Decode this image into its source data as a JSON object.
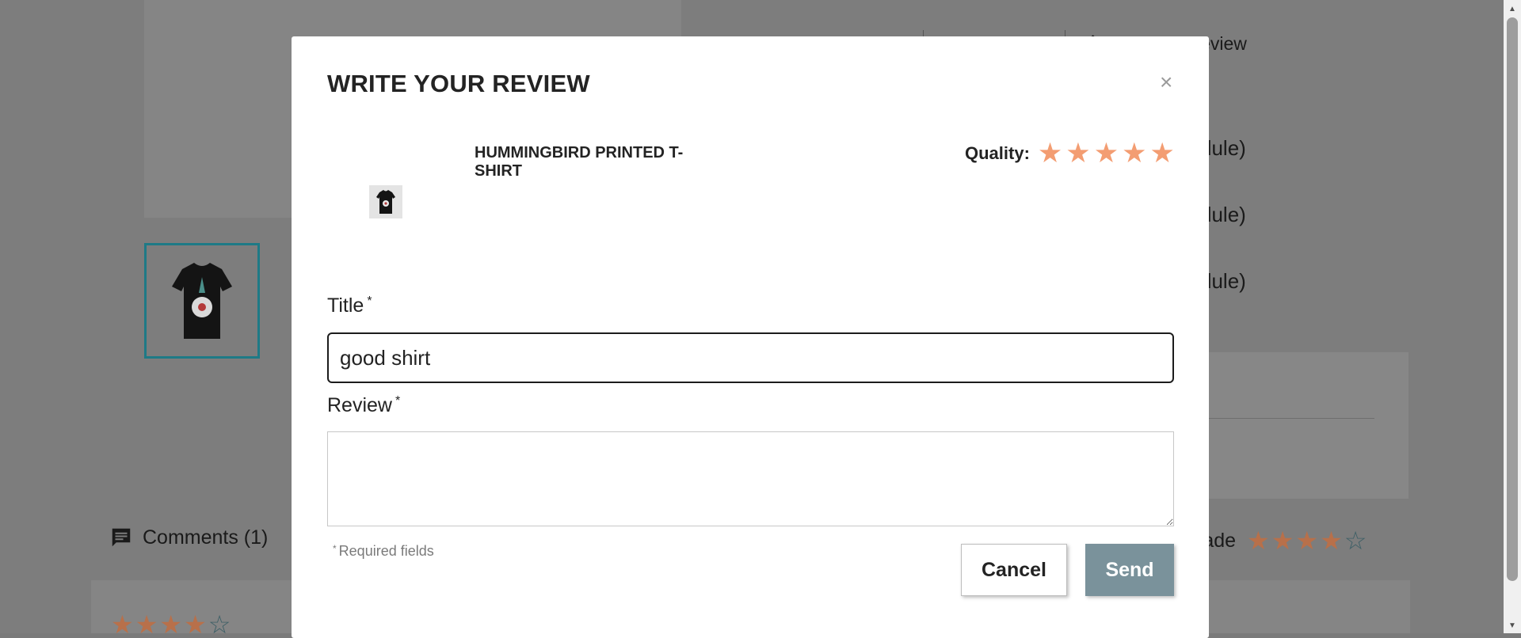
{
  "background": {
    "write_review_label": "Write your review",
    "list_fragments": [
      "dule)",
      "dule)",
      "dule)"
    ],
    "comments_label": "Comments (1)",
    "grade_label": "rade",
    "grade_stars": {
      "filled": "★★★★",
      "empty": "☆"
    }
  },
  "modal": {
    "title": "WRITE YOUR REVIEW",
    "close_symbol": "×",
    "product_name": "HUMMINGBIRD PRINTED T-SHIRT",
    "quality_label": "Quality:",
    "quality_rating": 5,
    "quality_max": 5,
    "star_glyph": "★",
    "title_label": "Title",
    "title_value": "good shirt",
    "review_label": "Review",
    "review_value": "",
    "required_marker": "*",
    "required_note": "Required fields",
    "cancel_label": "Cancel",
    "send_label": "Send"
  },
  "colors": {
    "star_orange": "#f39d72",
    "send_button": "#7a929b",
    "thumbnail_border": "#1e7a86"
  }
}
